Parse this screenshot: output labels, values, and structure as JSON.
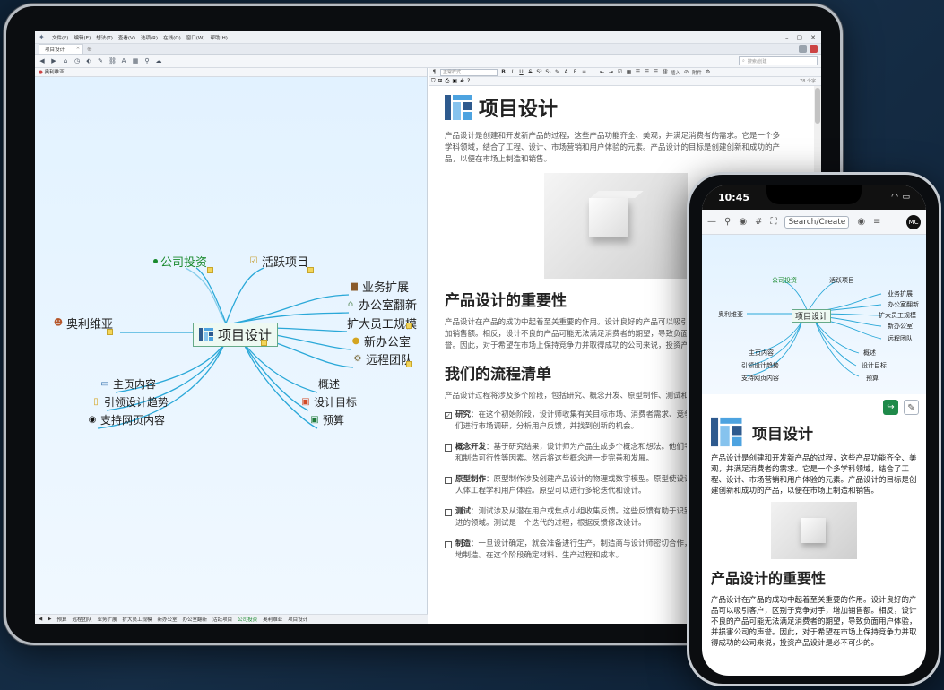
{
  "desktop": {
    "menu": [
      "文件(F)",
      "编辑(E)",
      "想法(T)",
      "查看(V)",
      "选项(R)",
      "在线(O)",
      "窗口(W)",
      "帮助(H)"
    ],
    "tab_title": "项目设计",
    "search_placeholder": "搜索/创建",
    "left_header": "奥利维亚",
    "format_style": "正常样式",
    "insert_label": "插入",
    "attach_label": "附件",
    "zoom": "78 个字",
    "bottom_tabs": [
      "预算",
      "远程团队",
      "业务扩展",
      "扩大员工规模",
      "新办公室",
      "办公室翻新",
      "活跃项目",
      "公司投资",
      "奥利维亚",
      "项目设计"
    ]
  },
  "mindmap": {
    "central": "项目设计",
    "nodes": {
      "invest": "公司投资",
      "active": "活跃项目",
      "biz": "业务扩展",
      "office_reno": "办公室翻新",
      "staff": "扩大员工规模",
      "new_office": "新办公室",
      "remote": "远程团队",
      "olivia": "奥利维亚",
      "homepage": "主页内容",
      "trend": "引领设计趋势",
      "support": "支持网页内容",
      "overview": "概述",
      "goal": "设计目标",
      "budget": "预算"
    }
  },
  "document": {
    "title": "项目设计",
    "intro": "产品设计是创建和开发新产品的过程，这些产品功能齐全、美观，并满足消费者的需求。它是一个多学科领域，结合了工程、设计、市场营销和用户体验的元素。产品设计的目标是创建创新和成功的产品，以便在市场上制造和销售。",
    "h2_importance": "产品设计的重要性",
    "importance": "产品设计在产品的成功中起着至关重要的作用。设计良好的产品可以吸引客户，区别于竞争对手，增加销售额。相反，设计不良的产品可能无法满足消费者的期望，导致负面用户体验，并损害公司的声誉。因此，对于希望在市场上保持竞争力并取得成功的公司来说，投资产品设计是必不可少的。",
    "h2_process": "我们的流程清单",
    "process_intro": "产品设计过程将涉及多个阶段，包括研究、概念开发、原型制作、测试和制造。",
    "tasks": [
      {
        "label": "研究",
        "checked": "✓",
        "text": "：在这个初始阶段，设计师收集有关目标市场、消费者需求、竞争对手和行业趋势的信息。他们进行市场调研，分析用户反馈，并找到创新的机会。"
      },
      {
        "label": "概念开发",
        "checked": "",
        "text": "：基于研究结果，设计师为产品生成多个概念和想法。他们考虑美学、人体工程学、材料和制造可行性等因素。然后将这些概念进一步完善和发展。"
      },
      {
        "label": "原型制作",
        "checked": "",
        "text": "：原型制作涉及创建产品设计的物理或数字模型。原型使设计师能够评估设计的功能性、人体工程学和用户体验。原型可以进行多轮迭代和设计。"
      },
      {
        "label": "测试",
        "checked": "",
        "text": "：测试涉及从潜在用户或焦点小组收集反馈。这些反馈有助于识别设计缺陷、可用性问题或改进的领域。测试是一个迭代的过程，根据反馈修改设计。"
      },
      {
        "label": "制造",
        "checked": "",
        "text": "：一旦设计确定，就会准备进行生产。制造商与设计师密切合作，确保产品可以在规模上可行地制造。在这个阶段确定材料、生产过程和成本。"
      }
    ]
  },
  "phone": {
    "time": "10:45",
    "search_label": "Search/Create",
    "avatar": "MC",
    "title": "项目设计",
    "intro": "产品设计是创建和开发新产品的过程，这些产品功能齐全、美观，并满足消费者的需求。它是一个多学科领域，结合了工程、设计、市场营销和用户体验的元素。产品设计的目标是创建创新和成功的产品，以便在市场上制造和销售。",
    "h2": "产品设计的重要性",
    "importance": "产品设计在产品的成功中起着至关重要的作用。设计良好的产品可以吸引客户，区别于竞争对手，增加销售额。相反，设计不良的产品可能无法满足消费者的期望，导致负面用户体验，并损害公司的声誉。因此，对于希望在市场上保持竞争力并取得成功的公司来说，投资产品设计是必不可少的。"
  },
  "colors": {
    "accent": "#2aa8d8",
    "brand_dark": "#2e5a8e",
    "note": "#f3d55a",
    "share_green": "#1f8a4a"
  }
}
